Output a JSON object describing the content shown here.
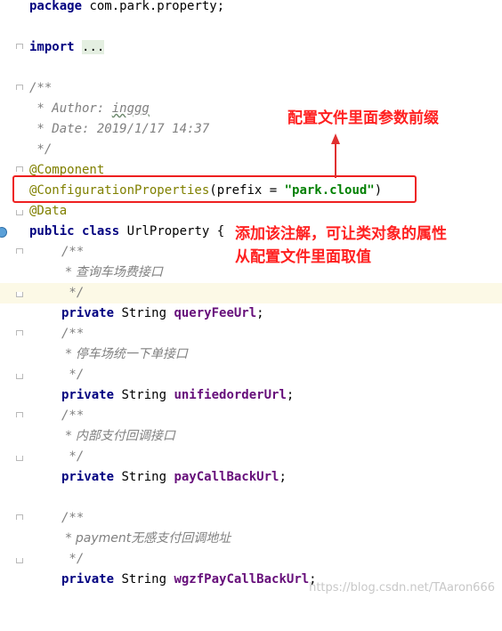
{
  "code": {
    "package_kw": "package",
    "package_name": " com.park.property;",
    "import_kw": "import",
    "import_dots": "...",
    "doc_open": "/**",
    "author_tag": " * Author: ",
    "author_val": "inggg",
    "date_line": " * Date: 2019/1/17 14:37",
    "doc_close": " */",
    "ann_component": "@Component",
    "ann_config": "@ConfigurationProperties",
    "config_paren_open": "(prefix = ",
    "config_prefix": "\"park.cloud\"",
    "config_paren_close": ")",
    "ann_data": "@Data",
    "class_public": "public",
    "class_kw": "class",
    "class_name": " UrlProperty {",
    "fields": [
      {
        "comment": " * 查询车场费接口",
        "type": " String ",
        "name": "queryFeeUrl"
      },
      {
        "comment": " * 停车场统一下单接口",
        "type": " String ",
        "name": "unifiedorderUrl"
      },
      {
        "comment": " * 内部支付回调接口",
        "type": " String ",
        "name": "payCallBackUrl"
      },
      {
        "comment": " * payment无感支付回调地址",
        "type": " String ",
        "name": "wgzfPayCallBackUrl"
      }
    ],
    "private_kw": "private",
    "semicolon": ";",
    "cmt_open": "/**",
    "cmt_close": " */"
  },
  "annotations": {
    "prefix_note": "配置文件里面参数前缀",
    "data_note_line1": "添加该注解，可让类对象的属性",
    "data_note_line2": "从配置文件里面取值"
  },
  "watermark": "https://blog.csdn.net/TAaron666",
  "colors": {
    "keyword": "#000080",
    "annotation": "#808000",
    "string": "#008000",
    "field": "#660e7a",
    "comment": "#808080",
    "callout": "#ff2020"
  }
}
